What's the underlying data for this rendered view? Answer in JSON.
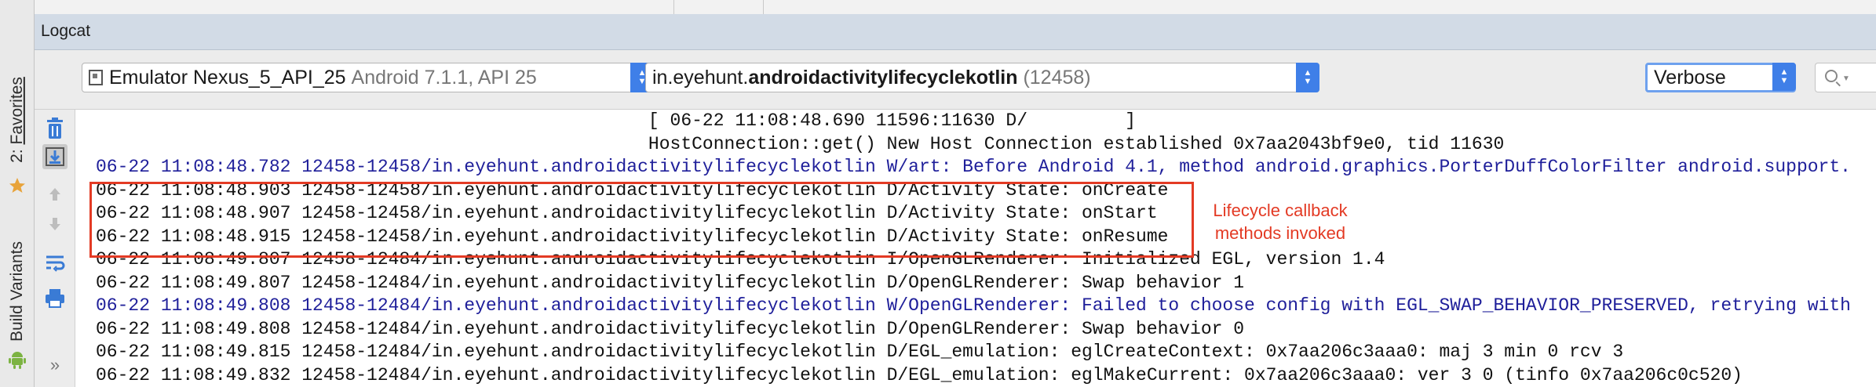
{
  "side_tabs": {
    "favorites_prefix": "2: ",
    "favorites": "Favorites",
    "build_variants": "Build Variants"
  },
  "logcat": {
    "title": "Logcat"
  },
  "toolbar": {
    "device_name": "Emulator Nexus_5_API_25",
    "device_detail": "Android 7.1.1, API 25",
    "process_prefix": "in.eyehunt.",
    "process_name": "androidactivitylifecyclekotlin",
    "process_pid": "(12458)",
    "log_level": "Verbose",
    "search_value": ""
  },
  "log_lines": [
    {
      "text": "                                                   [ 06-22 11:08:48.690 11596:11630 D/         ]",
      "level": "D"
    },
    {
      "text": "                                                   HostConnection::get() New Host Connection established 0x7aa2043bf9e0, tid 11630",
      "level": "D"
    },
    {
      "text": "06-22 11:08:48.782 12458-12458/in.eyehunt.androidactivitylifecyclekotlin W/art: Before Android 4.1, method android.graphics.PorterDuffColorFilter android.support.",
      "level": "W"
    },
    {
      "text": "06-22 11:08:48.903 12458-12458/in.eyehunt.androidactivitylifecyclekotlin D/Activity State: onCreate",
      "level": "D"
    },
    {
      "text": "06-22 11:08:48.907 12458-12458/in.eyehunt.androidactivitylifecyclekotlin D/Activity State: onStart",
      "level": "D"
    },
    {
      "text": "06-22 11:08:48.915 12458-12458/in.eyehunt.androidactivitylifecyclekotlin D/Activity State: onResume",
      "level": "D"
    },
    {
      "text": "06-22 11:08:49.807 12458-12484/in.eyehunt.androidactivitylifecyclekotlin I/OpenGLRenderer: Initialized EGL, version 1.4",
      "level": "I"
    },
    {
      "text": "06-22 11:08:49.807 12458-12484/in.eyehunt.androidactivitylifecyclekotlin D/OpenGLRenderer: Swap behavior 1",
      "level": "D"
    },
    {
      "text": "06-22 11:08:49.808 12458-12484/in.eyehunt.androidactivitylifecyclekotlin W/OpenGLRenderer: Failed to choose config with EGL_SWAP_BEHAVIOR_PRESERVED, retrying with",
      "level": "W"
    },
    {
      "text": "06-22 11:08:49.808 12458-12484/in.eyehunt.androidactivitylifecyclekotlin D/OpenGLRenderer: Swap behavior 0",
      "level": "D"
    },
    {
      "text": "06-22 11:08:49.815 12458-12484/in.eyehunt.androidactivitylifecyclekotlin D/EGL_emulation: eglCreateContext: 0x7aa206c3aaa0: maj 3 min 0 rcv 3",
      "level": "D"
    },
    {
      "text": "06-22 11:08:49.832 12458-12484/in.eyehunt.androidactivitylifecyclekotlin D/EGL_emulation: eglMakeCurrent: 0x7aa206c3aaa0: ver 3 0 (tinfo 0x7aa206c0c520)",
      "level": "D"
    }
  ],
  "annotation": {
    "line1": "Lifecycle callback",
    "line2": "methods invoked"
  },
  "colors": {
    "annotation_red": "#e33a24",
    "warning_blue": "#1f1f9a",
    "combo_accent": "#3f7fe8",
    "header_bg": "#d2dbe6"
  },
  "icons": [
    "trash-icon",
    "scroll-to-end-icon",
    "up-arrow-icon",
    "down-arrow-icon",
    "soft-wrap-icon",
    "print-icon",
    "more-icon",
    "star-icon",
    "android-icon",
    "device-icon",
    "search-icon"
  ]
}
